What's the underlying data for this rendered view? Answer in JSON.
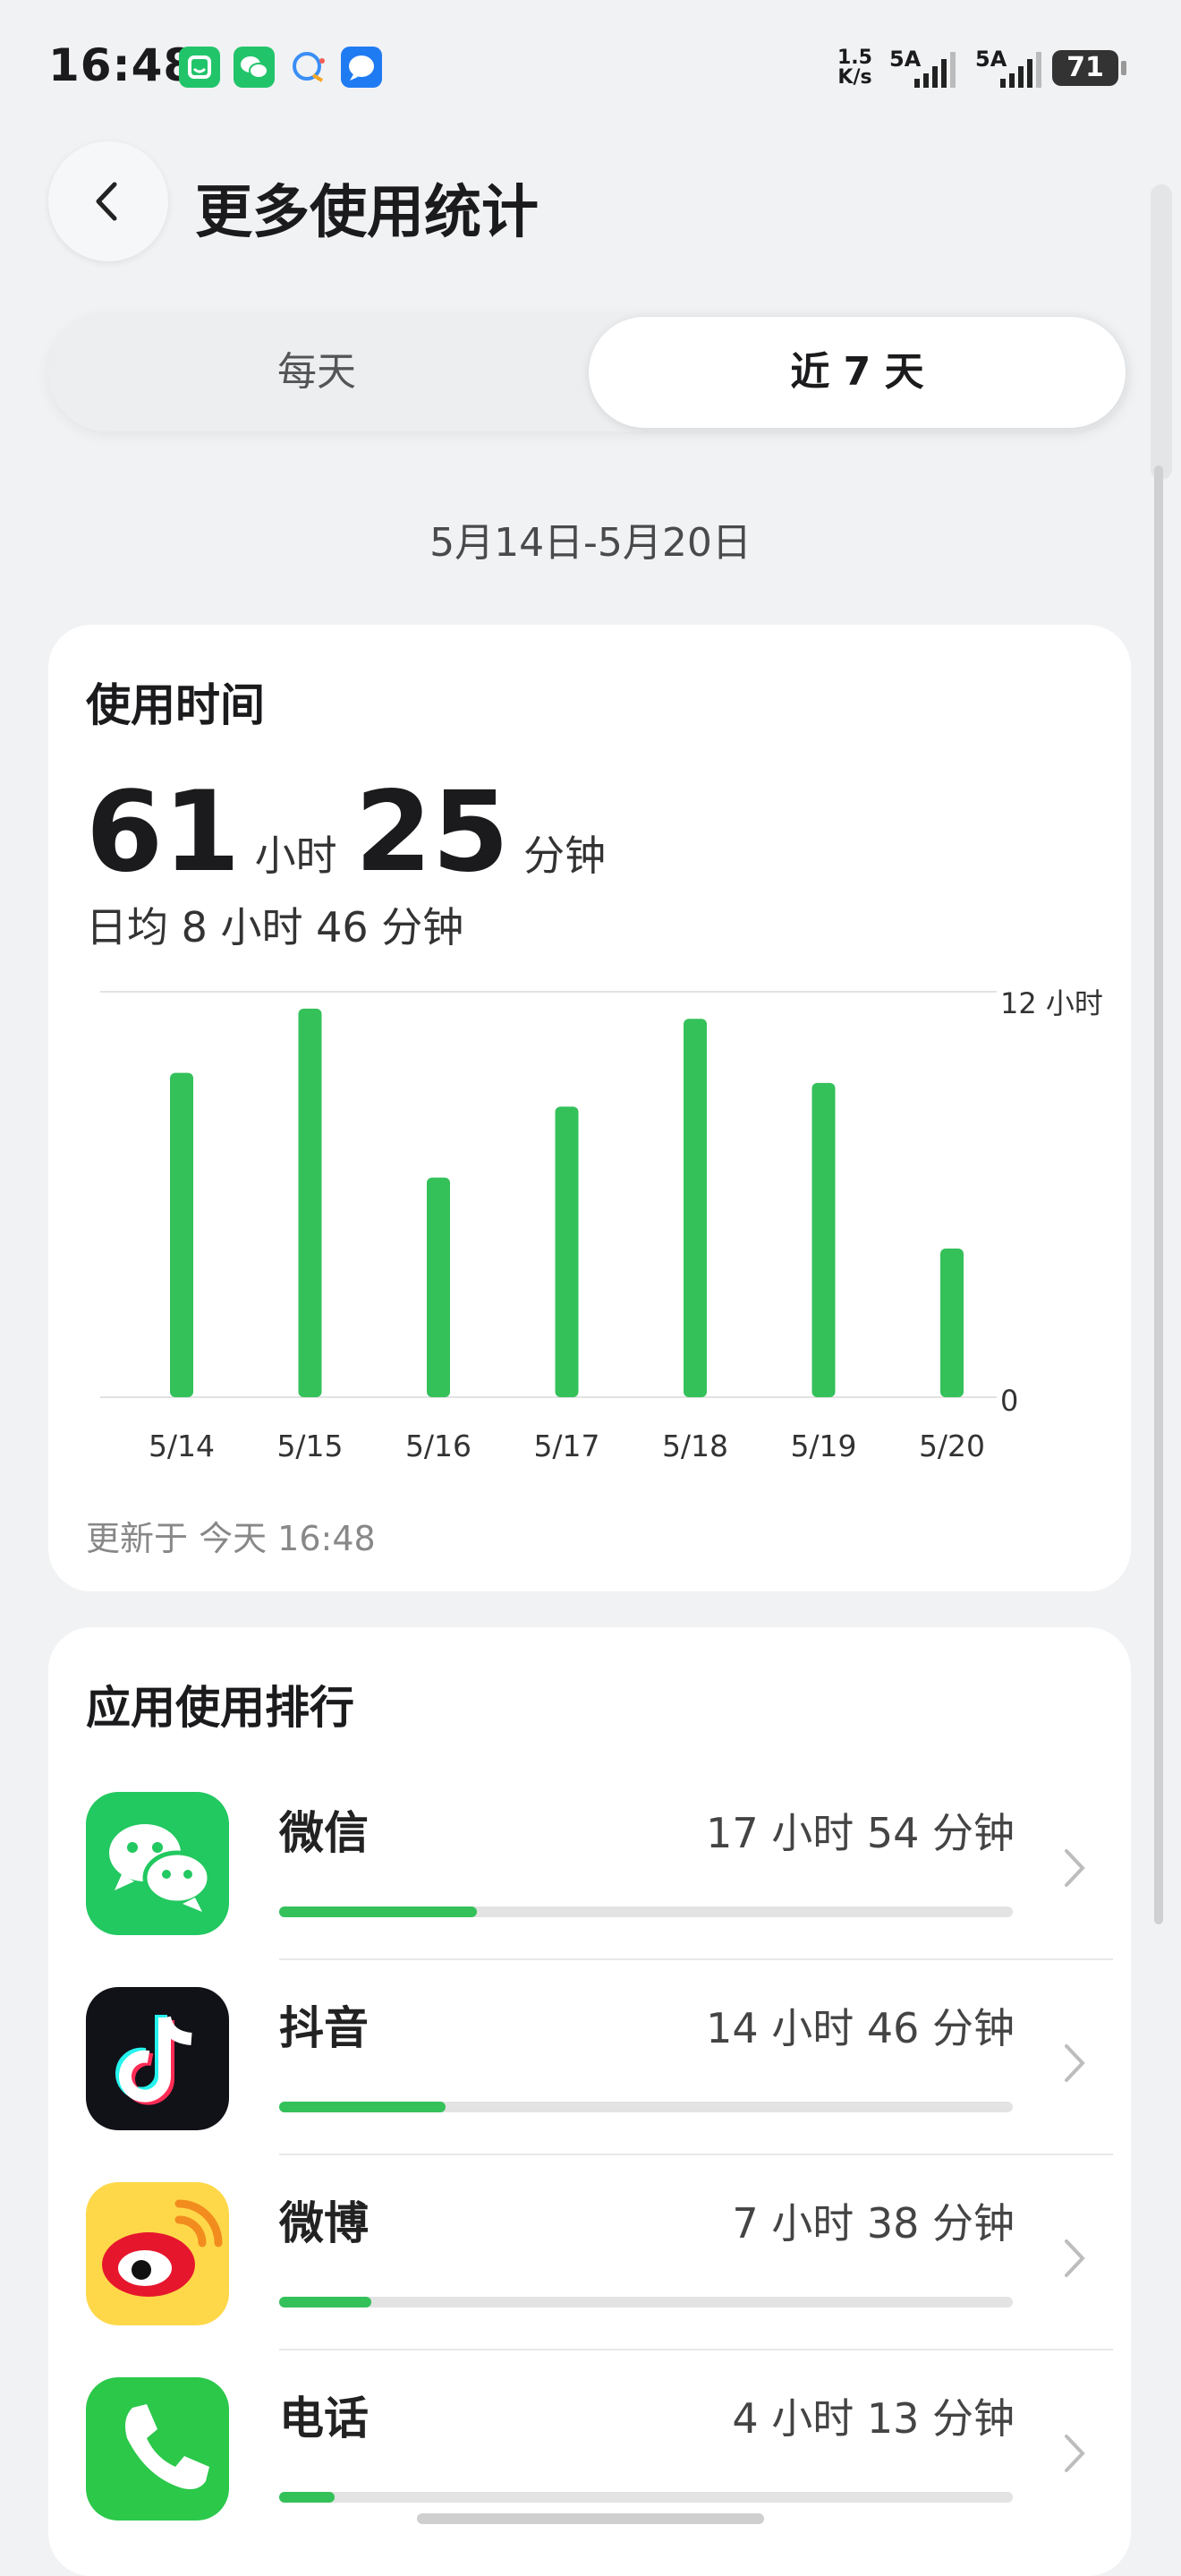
{
  "status_bar": {
    "time": "16:48",
    "net_speed_value": "1.5",
    "net_speed_unit": "K/s",
    "signal1_label": "5A",
    "signal2_label": "5A",
    "battery": "71"
  },
  "header": {
    "title": "更多使用统计"
  },
  "segmented": {
    "daily": "每天",
    "week": "近 7 天"
  },
  "date_range": "5月14日-5月20日",
  "usage_card": {
    "title": "使用时间",
    "hours": "61",
    "hours_unit": "小时",
    "minutes": "25",
    "minutes_unit": "分钟",
    "average": "日均 8 小时 46 分钟",
    "updated": "更新于 今天 16:48"
  },
  "chart_data": {
    "type": "bar",
    "categories": [
      "5/14",
      "5/15",
      "5/16",
      "5/17",
      "5/18",
      "5/19",
      "5/20"
    ],
    "values": [
      9.6,
      11.5,
      6.5,
      8.6,
      11.2,
      9.3,
      4.4
    ],
    "y_ticks": [
      "12 小时",
      "0"
    ],
    "ylim": [
      0,
      12
    ],
    "bar_color": "#34c15a"
  },
  "ranking": {
    "title": "应用使用排行",
    "apps": [
      {
        "name": "微信",
        "time": "17 小时 54 分钟",
        "fraction": 0.27,
        "icon": "wechat-icon"
      },
      {
        "name": "抖音",
        "time": "14 小时 46 分钟",
        "fraction": 0.227,
        "icon": "douyin-icon"
      },
      {
        "name": "微博",
        "time": "7 小时 38 分钟",
        "fraction": 0.125,
        "icon": "weibo-icon"
      },
      {
        "name": "电话",
        "time": "4 小时 13 分钟",
        "fraction": 0.075,
        "icon": "phone-icon"
      }
    ]
  },
  "colors": {
    "accent_green": "#34c15a",
    "background": "#f1f2f4",
    "card": "#ffffff"
  }
}
